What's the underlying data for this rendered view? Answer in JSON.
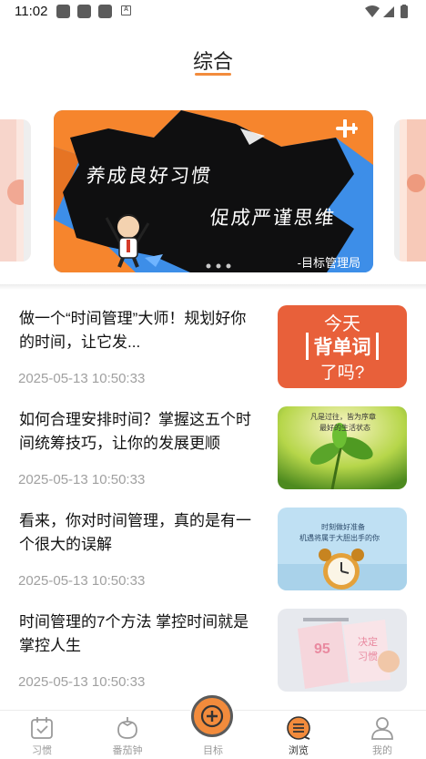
{
  "status_bar": {
    "time": "11:02",
    "indicator": "A"
  },
  "header": {
    "title": "综合"
  },
  "banner": {
    "line1": "养成良好习惯",
    "line2": "促成严谨思维",
    "brand": "-目标管理局"
  },
  "articles": [
    {
      "title": "做一个“时间管理”大师！规划好你的时间，让它发...",
      "date": "2025-05-13 10:50:33",
      "thumb": {
        "line1": "今天",
        "line2": "背单词",
        "line3": "了吗?"
      }
    },
    {
      "title": "如何合理安排时间？掌握这五个时间统筹技巧，让你的发展更顺",
      "date": "2025-05-13 10:50:33",
      "thumb": {
        "line1": "凡是过往，皆为序章",
        "line2": "最好的生活状态",
        "line3": ""
      }
    },
    {
      "title": "看来，你对时间管理，真的是有一个很大的误解",
      "date": "2025-05-13 10:50:33",
      "thumb": {
        "line1": "时刻做好准备",
        "line2": "机遇将属于大胆出手的你",
        "line3": ""
      }
    },
    {
      "title": "时间管理的7个方法 掌控时间就是掌控人生",
      "date": "2025-05-13 10:50:33",
      "thumb": {
        "line1": "95",
        "line2": "决定",
        "line3": "习惯"
      }
    }
  ],
  "bottom_nav": {
    "habit": "习惯",
    "pomodoro": "番茄钟",
    "goal": "目标",
    "browse": "浏览",
    "mine": "我的"
  },
  "colors": {
    "accent": "#f28b3c",
    "banner_orange": "#f6852d",
    "banner_blue": "#3d8ee8",
    "thumb1_bg": "#e8603a"
  }
}
